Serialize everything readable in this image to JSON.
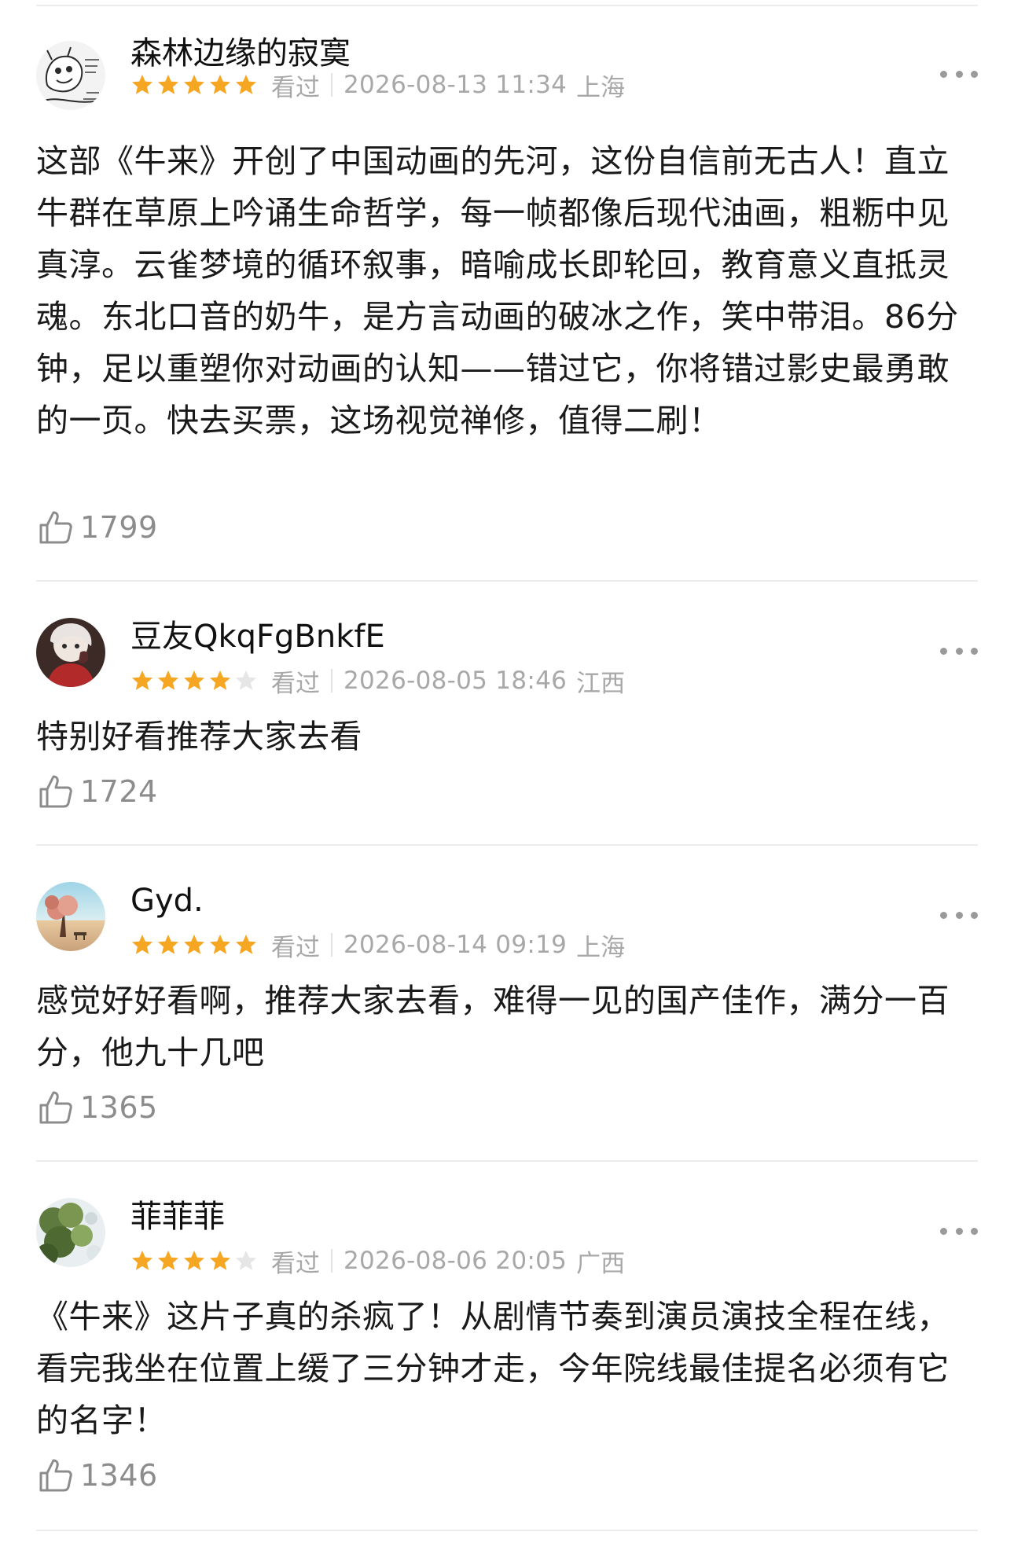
{
  "colors": {
    "star_filled": "#f5a623",
    "star_empty": "#e6e6e6",
    "meta_text": "#a8a8a8",
    "like_text": "#8c8c8c",
    "divider": "#ececec"
  },
  "reviews": [
    {
      "username": "森林边缘的寂寞",
      "rating": 5,
      "status": "看过",
      "datetime": "2026-08-13 11:34",
      "location": "上海",
      "content": "这部《牛来》开创了中国动画的先河，这份自信前无古人！直立牛群在草原上吟诵生命哲学，每一帧都像后现代油画，粗粝中见真淳。云雀梦境的循环叙事，暗喻成长即轮回，教育意义直抵灵魂。东北口音的奶牛，是方言动画的破冰之作，笑中带泪。86分钟，足以重塑你对动画的认知——错过它，你将错过影史最勇敢的一页。快去买票，这场视觉禅修，值得二刷！",
      "likes": "1799",
      "avatar_icon": "sketch-avatar-icon"
    },
    {
      "username": "豆友QkqFgBnkfE",
      "rating": 4,
      "status": "看过",
      "datetime": "2026-08-05 18:46",
      "location": "江西",
      "content": "特别好看推荐大家去看",
      "likes": "1724",
      "avatar_icon": "person-avatar-icon"
    },
    {
      "username": "Gyd.",
      "rating": 5,
      "status": "看过",
      "datetime": "2026-08-14 09:19",
      "location": "上海",
      "content": "感觉好好看啊，推荐大家去看，难得一见的国产佳作，满分一百分，他九十几吧",
      "likes": "1365",
      "avatar_icon": "tree-avatar-icon"
    },
    {
      "username": "菲菲菲",
      "rating": 4,
      "status": "看过",
      "datetime": "2026-08-06 20:05",
      "location": "广西",
      "content": "《牛来》这片子真的杀疯了！从剧情节奏到演员演技全程在线，看完我坐在位置上缓了三分钟才走，今年院线最佳提名必须有它的名字！",
      "likes": "1346",
      "avatar_icon": "leaves-avatar-icon"
    }
  ]
}
